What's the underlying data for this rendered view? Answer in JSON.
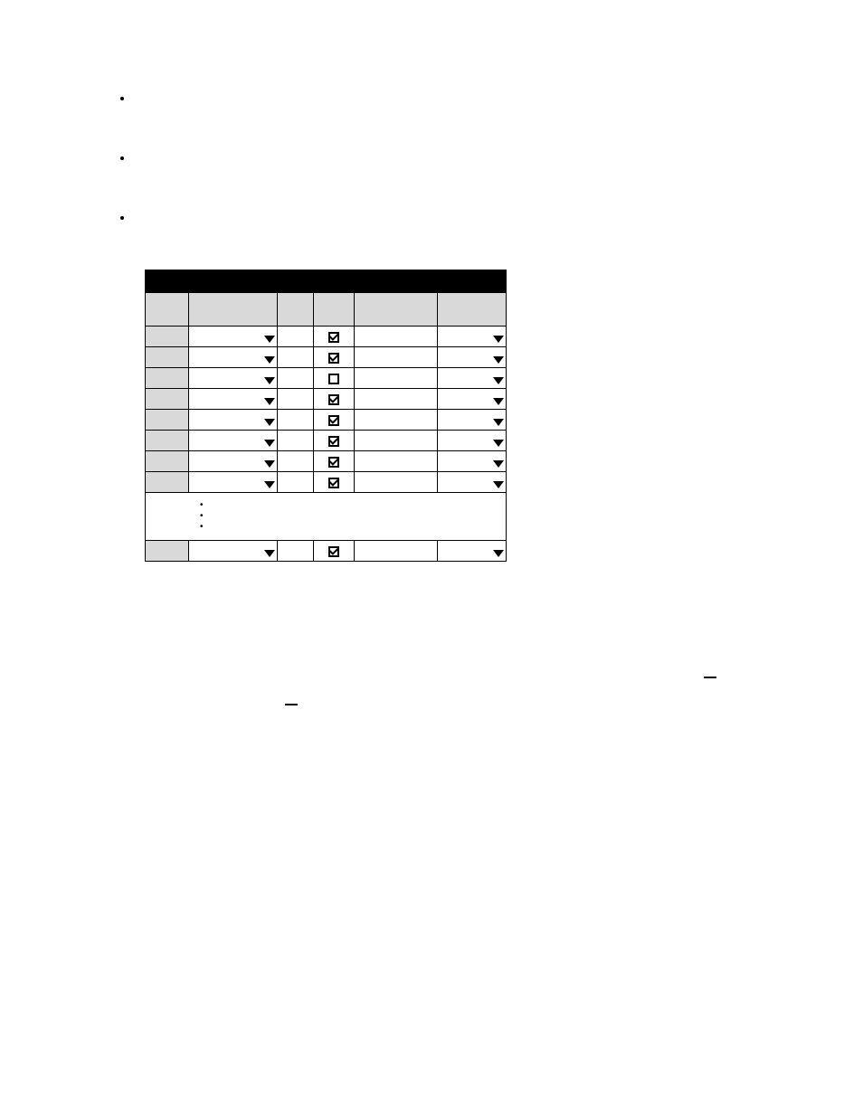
{
  "bullets": [
    "",
    "",
    ""
  ],
  "table": {
    "columns": 6,
    "rows": [
      {
        "checked": true
      },
      {
        "checked": true
      },
      {
        "checked": false
      },
      {
        "checked": true
      },
      {
        "checked": true
      },
      {
        "checked": true
      },
      {
        "checked": true
      },
      {
        "checked": true
      }
    ],
    "final_row": {
      "checked": true
    }
  }
}
